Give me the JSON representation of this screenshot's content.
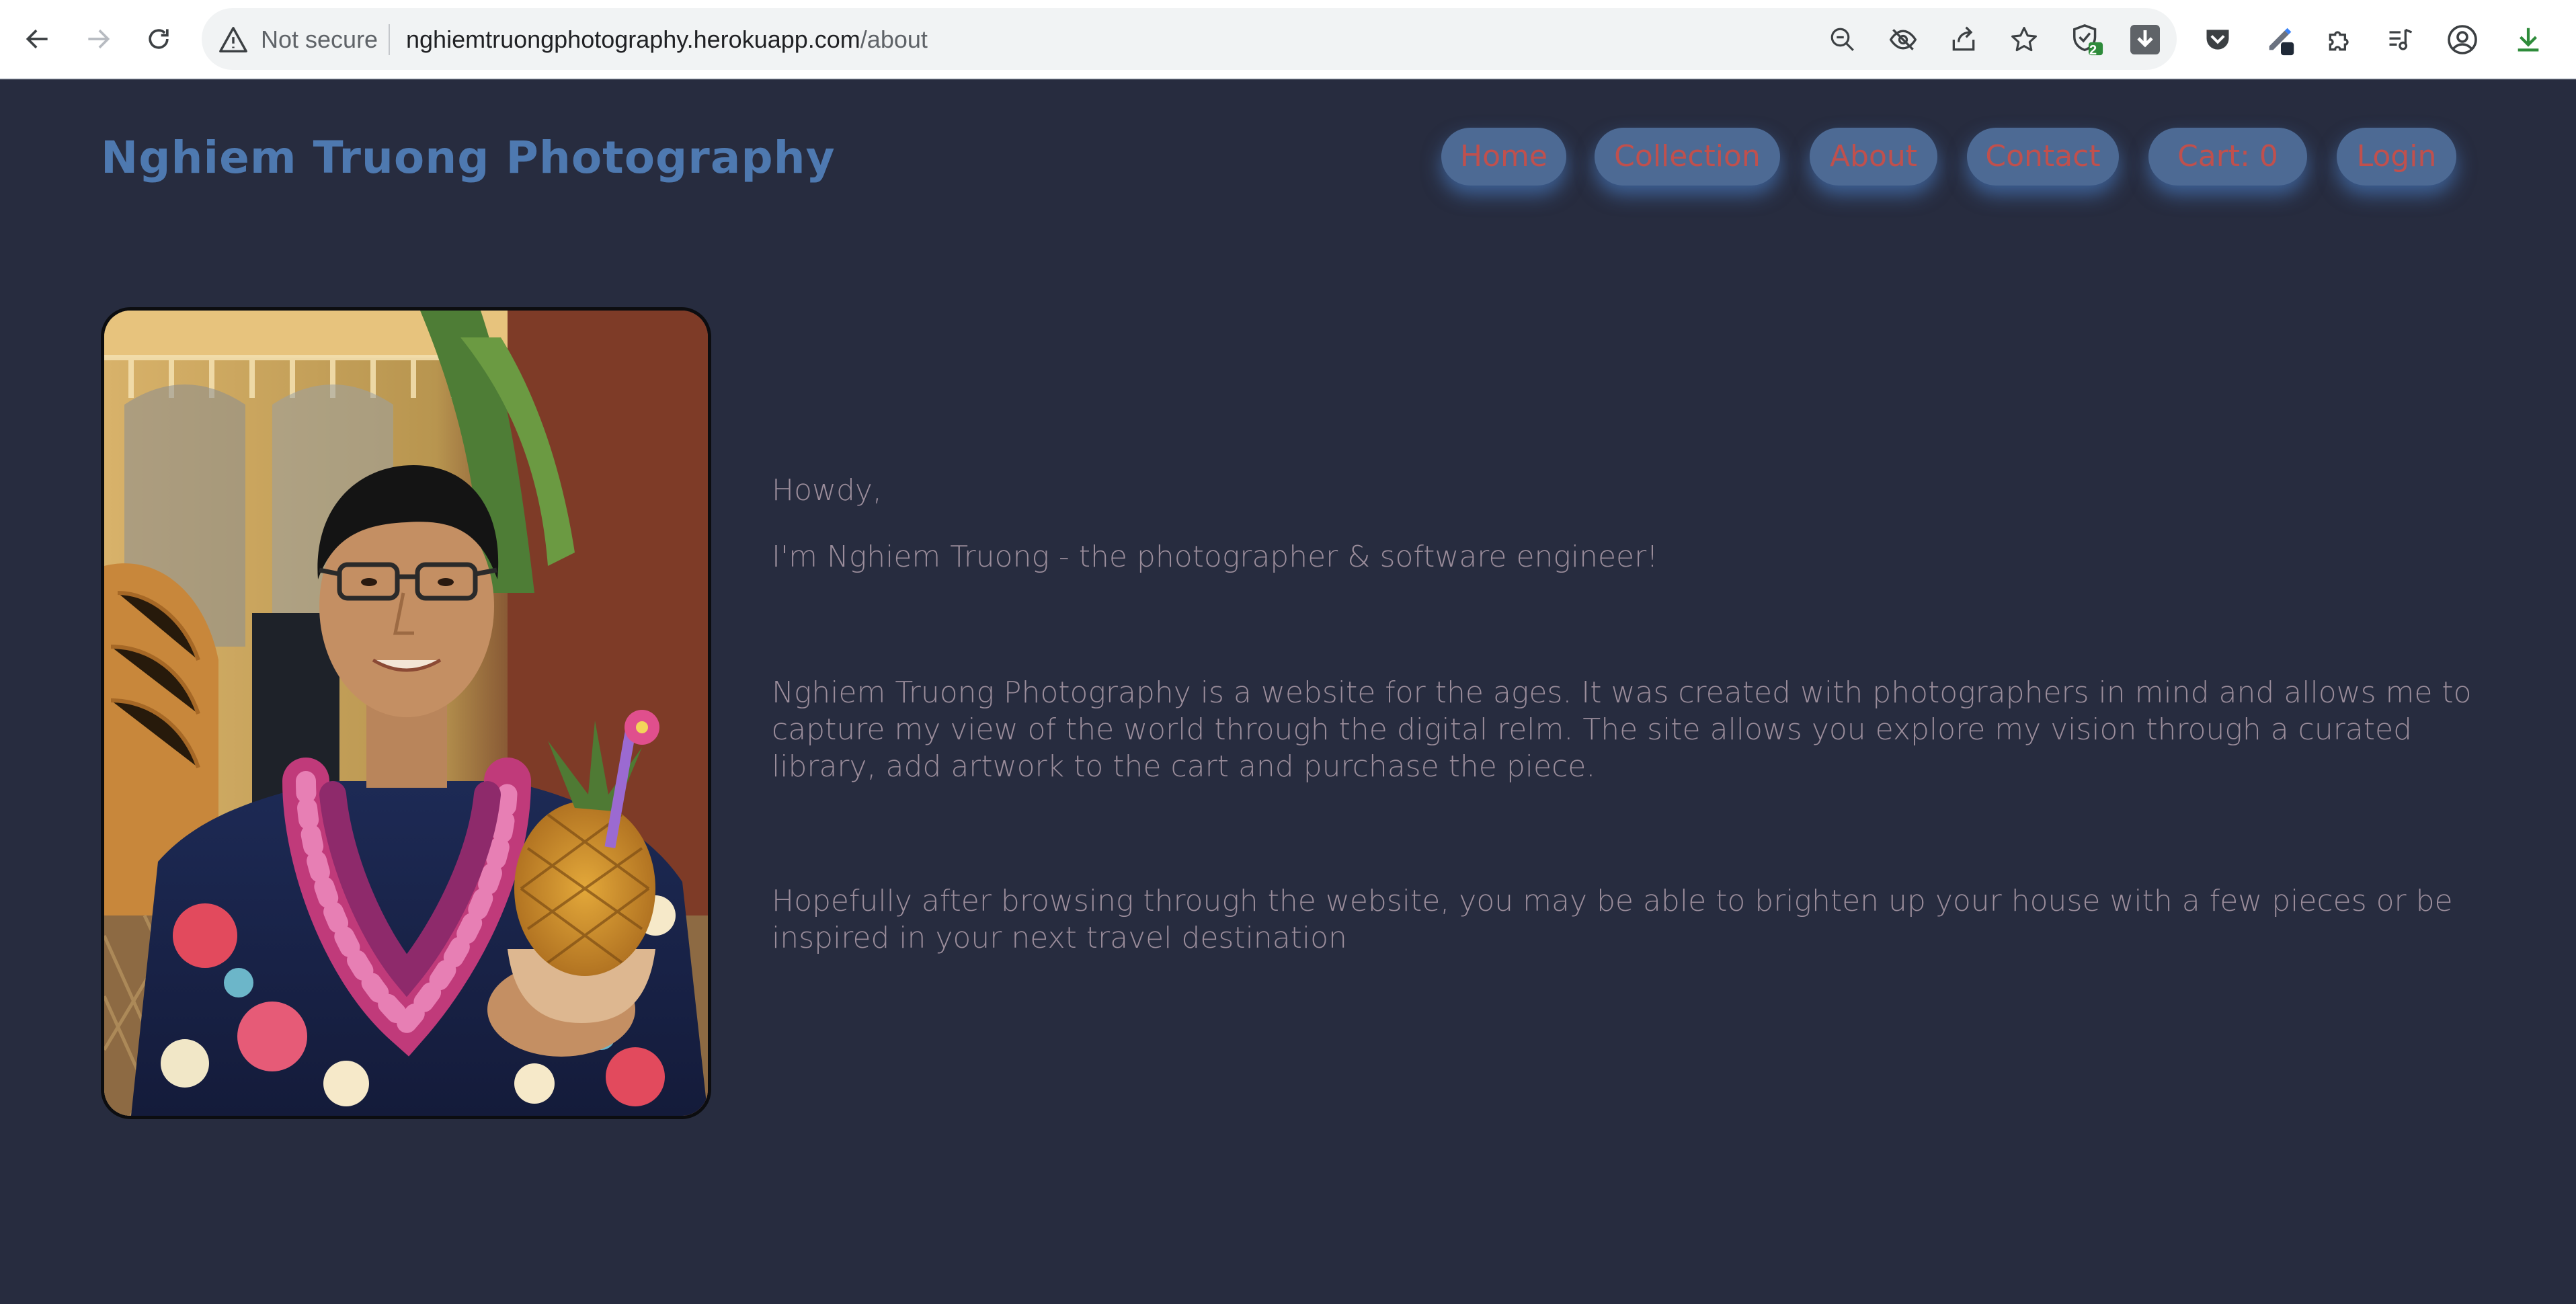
{
  "browser": {
    "security_label": "Not secure",
    "url_host": "nghiemtruongphotography.herokuapp.com",
    "url_path": "/about",
    "shield_badge": "2",
    "icons": [
      "back-arrow-icon",
      "forward-arrow-icon",
      "reload-icon",
      "warning-icon",
      "zoom-out-icon",
      "eye-off-icon",
      "share-icon",
      "star-icon",
      "shield-check-icon",
      "download-arrow-icon",
      "pocket-icon",
      "pen-extension-icon",
      "puzzle-icon",
      "music-list-icon",
      "profile-icon",
      "download-icon"
    ]
  },
  "site": {
    "title": "Nghiem Truong Photography",
    "nav": [
      "Home",
      "Collection",
      "About",
      "Contact",
      "Cart: 0",
      "Login"
    ]
  },
  "about": {
    "greeting": "Howdy,",
    "intro": "I'm Nghiem Truong - the photographer & software engineer!",
    "paragraph1": "Nghiem Truong Photography is a website for the ages. It was created with photographers in mind and allows me to capture my view of the world through the digital relm. The site allows you explore my vision through a curated library, add artwork to the cart and purchase the piece.",
    "paragraph2": "Hopefully after browsing through the website, you may be able to brighten up your house with a few pieces or be inspired in your next travel destination"
  },
  "colors": {
    "page_bg": "#272c3f",
    "title": "#4e79b0",
    "nav_bg": "#4d6a94",
    "nav_text": "#c0504d",
    "body_text": "#9b8d9b"
  }
}
